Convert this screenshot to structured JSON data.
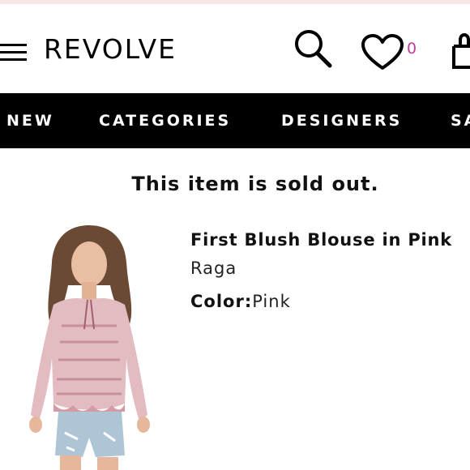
{
  "header": {
    "logo": "REVOLVE",
    "wishlist_count": "0",
    "icons": [
      "menu-icon",
      "search-icon",
      "heart-icon",
      "shopping-bag-icon"
    ],
    "accent_color": "#c1399b"
  },
  "nav": {
    "items": [
      {
        "label": "NEW"
      },
      {
        "label": "CATEGORIES"
      },
      {
        "label": "DESIGNERS"
      },
      {
        "label": "SA"
      }
    ]
  },
  "notice": {
    "text": "This item is sold out."
  },
  "product": {
    "title": "First Blush Blouse in Pink",
    "brand": "Raga",
    "color_label": "Color:",
    "color_value": "Pink"
  }
}
